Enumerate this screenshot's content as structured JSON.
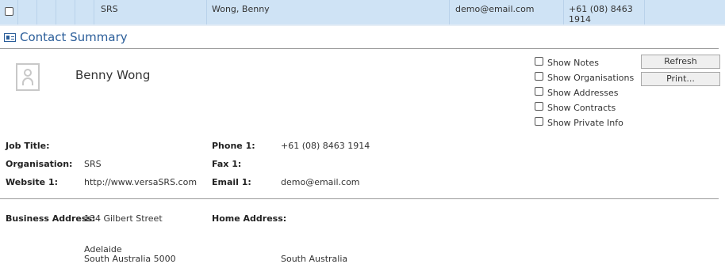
{
  "grid_row": {
    "col_company": "SRS",
    "col_name": "Wong, Benny",
    "col_email": "demo@email.com",
    "col_phone_line1": "+61 (08) 8463",
    "col_phone_line2": "1914"
  },
  "section": {
    "title": "Contact Summary"
  },
  "contact": {
    "full_name": "Benny Wong"
  },
  "options": [
    {
      "label": "Show Notes"
    },
    {
      "label": "Show Organisations"
    },
    {
      "label": "Show Addresses"
    },
    {
      "label": "Show Contracts"
    },
    {
      "label": "Show Private Info"
    }
  ],
  "buttons": {
    "refresh": "Refresh",
    "print": "Print..."
  },
  "fields": {
    "job_title_label": "Job Title:",
    "organisation_label": "Organisation:",
    "organisation_value": "SRS",
    "website_label": "Website 1:",
    "website_value": "http://www.versaSRS.com",
    "phone_label": "Phone 1:",
    "phone_value": "+61 (08) 8463 1914",
    "fax_label": "Fax 1:",
    "email_label": "Email 1:",
    "email_value": "demo@email.com"
  },
  "addresses": {
    "business_label": "Business Address:",
    "business_line1": "134 Gilbert Street",
    "business_line2": "Adelaide",
    "business_line3": "South Australia 5000",
    "home_label": "Home Address:",
    "home_line3": "South Australia"
  }
}
